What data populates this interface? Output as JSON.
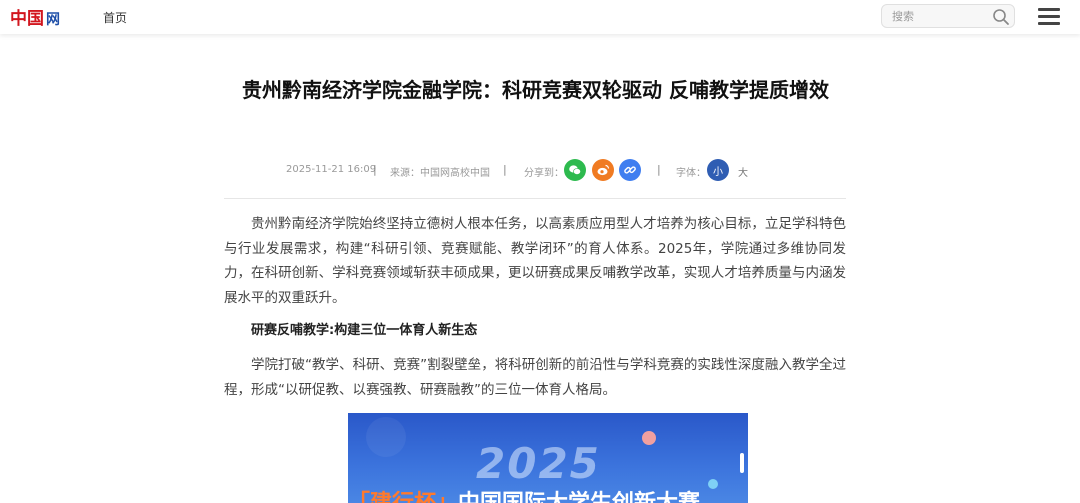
{
  "header": {
    "logo_text": "中国网",
    "nav_home": "首页",
    "search_placeholder": "搜索"
  },
  "article": {
    "title": "贵州黔南经济学院金融学院：科研竞赛双轮驱动 反哺教学提质增效",
    "date": "2025-11-21 16:09",
    "source": "来源：中国网高校中国",
    "share_label": "分享到：",
    "font_label": "字体：",
    "font_small": "小",
    "font_large": "大",
    "paragraph1": "贵州黔南经济学院始终坚持立德树人根本任务，以高素质应用型人才培养为核心目标，立足学科特色与行业发展需求，构建“科研引领、竞赛赋能、教学闭环”的育人体系。2025年，学院通过多维协同发力，在科研创新、学科竞赛领域斩获丰硕成果，更以研赛成果反哺教学改革，实现人才培养质量与内涵发展水平的双重跃升。",
    "subheading": "研赛反哺教学:构建三位一体育人新生态",
    "paragraph2": "学院打破“教学、科研、竞赛”割裂壁垒，将科研创新的前沿性与学科竞赛的实践性深度融入教学全过程，形成“以研促教、以赛强教、研赛融教”的三位一体育人格局。",
    "image_year": "2025",
    "image_banner_tag": "「建行杯」",
    "image_banner_text": "中国国际大学生创新大赛"
  },
  "colors": {
    "wechat": "#2dba4e",
    "weibo": "#f07b22",
    "link": "#3f7ef0",
    "font_small_active": "#2f5db3",
    "logo_red": "#d2161e",
    "logo_blue": "#1f4fa8"
  },
  "icons": {
    "search": "search-icon",
    "menu": "hamburger-menu-icon",
    "wechat": "wechat-icon",
    "weibo": "weibo-icon",
    "link": "link-icon"
  }
}
